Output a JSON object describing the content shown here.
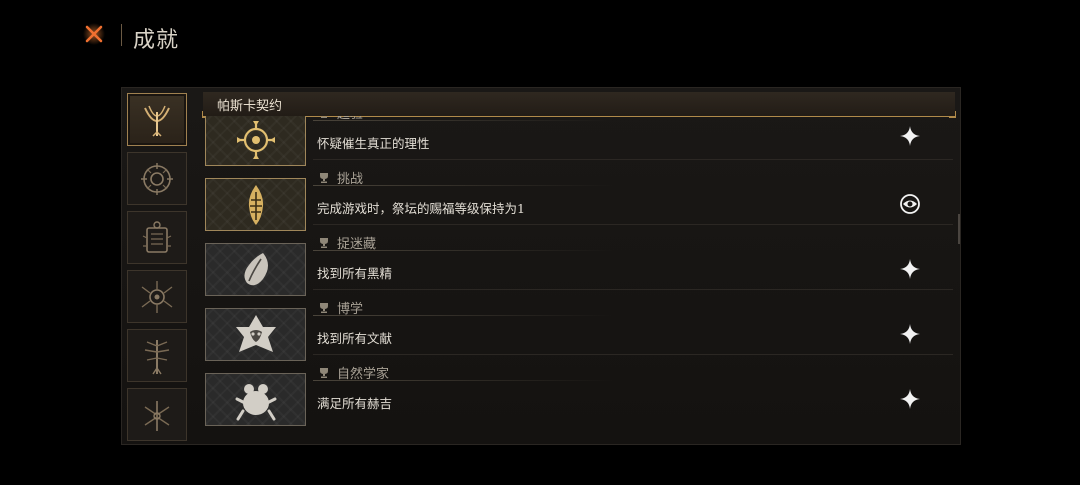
{
  "header": {
    "title": "成就"
  },
  "colors": {
    "close_icon": "#e8622a",
    "gold_accent": "#c9a25a",
    "panel_bg": "#161412"
  },
  "categories": [
    {
      "icon": "crescent-sigil-icon",
      "active": true
    },
    {
      "icon": "ring-sigil-icon",
      "active": false
    },
    {
      "icon": "tablet-sigil-icon",
      "active": false
    },
    {
      "icon": "spider-sigil-icon",
      "active": false
    },
    {
      "icon": "tree-sigil-icon",
      "active": false
    },
    {
      "icon": "thorn-sigil-icon",
      "active": false
    }
  ],
  "section": {
    "title": "帕斯卡契约"
  },
  "achievements": [
    {
      "title": "超验",
      "description": "怀疑催生真正的理性",
      "icon": "crosshair-sun-icon",
      "status": "sparkle-icon",
      "gold": true
    },
    {
      "title": "挑战",
      "description": "完成游戏时，祭坛的赐福等级保持为1",
      "icon": "flame-sigil-icon",
      "status": "eye-sigil-icon",
      "gold": true
    },
    {
      "title": "捉迷藏",
      "description": "找到所有黑精",
      "icon": "leaf-seed-icon",
      "status": "sparkle-icon",
      "gold": false
    },
    {
      "title": "博学",
      "description": "找到所有文献",
      "icon": "star-mask-icon",
      "status": "sparkle-icon",
      "gold": false
    },
    {
      "title": "自然学家",
      "description": "满足所有赫吉",
      "icon": "frog-icon",
      "status": "sparkle-icon",
      "gold": false
    }
  ]
}
